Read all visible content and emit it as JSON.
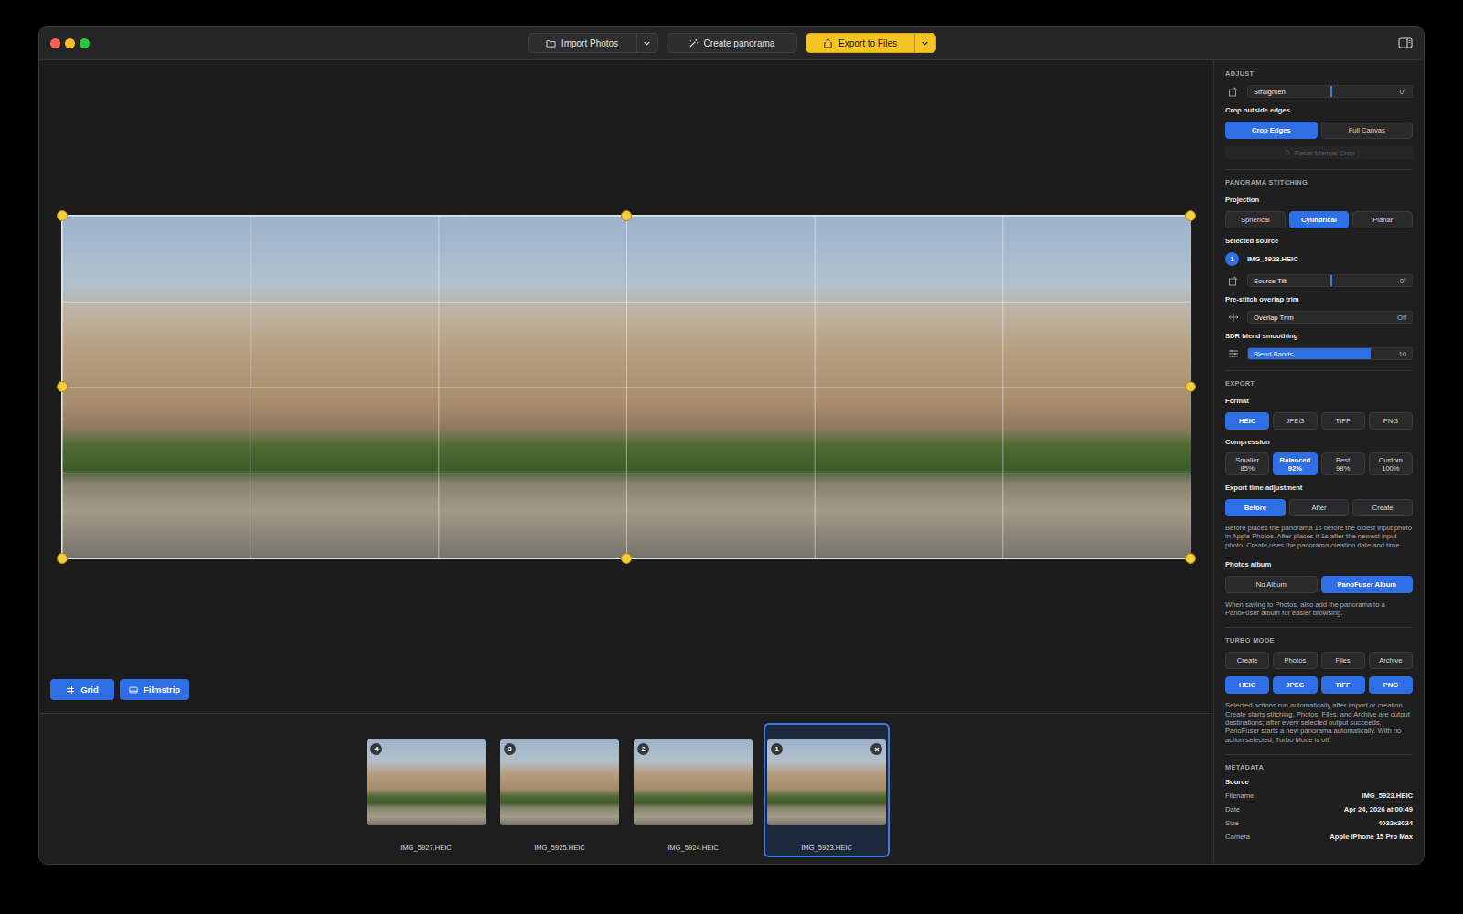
{
  "toolbar": {
    "buttons": [
      {
        "label": "Import Photos",
        "kind": "split",
        "primary": false,
        "icon": "folder"
      },
      {
        "label": "Create panorama",
        "kind": "plain",
        "primary": false,
        "icon": "wand"
      },
      {
        "label": "Export to Files",
        "kind": "split",
        "primary": true,
        "icon": "share"
      }
    ]
  },
  "view_buttons": [
    {
      "label": "Grid",
      "selected": true,
      "icon": "grid"
    },
    {
      "label": "Filmstrip",
      "selected": true,
      "icon": "filmstrip"
    }
  ],
  "filmstrip": [
    {
      "badge": "4",
      "filename": "IMG_5927.HEIC",
      "selected": false
    },
    {
      "badge": "3",
      "filename": "IMG_5925.HEIC",
      "selected": false
    },
    {
      "badge": "2",
      "filename": "IMG_5924.HEIC",
      "selected": false
    },
    {
      "badge": "1",
      "filename": "IMG_5923.HEIC",
      "selected": true
    }
  ],
  "adjust": {
    "heading": "ADJUST",
    "straighten": {
      "label": "Straighten",
      "value": "0°",
      "level": 0.5,
      "kind": "marker"
    },
    "crop": {
      "label": "Crop outside edges",
      "options": [
        {
          "label": "Crop Edges",
          "selected": true
        },
        {
          "label": "Full Canvas",
          "selected": false
        }
      ],
      "reset": {
        "label": "Reset Manual Crop",
        "disabled": true
      }
    }
  },
  "stitching": {
    "heading": "PANORAMA STITCHING",
    "projection": {
      "label": "Projection",
      "options": [
        {
          "label": "Spherical",
          "selected": false
        },
        {
          "label": "Cylindrical",
          "selected": true
        },
        {
          "label": "Planar",
          "selected": false
        }
      ]
    },
    "source": {
      "label": "Selected source",
      "badge": "1",
      "filename": "IMG_5923.HEIC",
      "tilt": {
        "label": "Source Tilt",
        "value": "0°",
        "level": 0.5,
        "kind": "marker"
      }
    },
    "overlap": {
      "label": "Pre-stitch overlap trim",
      "slider": {
        "label": "Overlap Trim",
        "value": "Off",
        "level": 0,
        "kind": "fill"
      }
    },
    "blend": {
      "label": "SDR blend smoothing",
      "slider": {
        "label": "Blend Bands",
        "value": "10",
        "level": 0.75,
        "kind": "fill"
      }
    }
  },
  "export": {
    "heading": "EXPORT",
    "format": {
      "label": "Format",
      "options": [
        {
          "label": "HEIC",
          "selected": true
        },
        {
          "label": "JPEG",
          "selected": false
        },
        {
          "label": "TIFF",
          "selected": false
        },
        {
          "label": "PNG",
          "selected": false
        }
      ]
    },
    "compression": {
      "label": "Compression",
      "options": [
        {
          "label": "Smaller",
          "value": "85%",
          "selected": false
        },
        {
          "label": "Balanced",
          "value": "92%",
          "selected": true
        },
        {
          "label": "Best",
          "value": "98%",
          "selected": false
        },
        {
          "label": "Custom",
          "value": "100%",
          "selected": false
        }
      ]
    },
    "time": {
      "label": "Export time adjustment",
      "options": [
        {
          "label": "Before",
          "selected": true
        },
        {
          "label": "After",
          "selected": false
        },
        {
          "label": "Create",
          "selected": false
        }
      ],
      "note": "Before places the panorama 1s before the oldest input photo in Apple Photos. After places it 1s after the newest input photo. Create uses the panorama creation date and time."
    },
    "album": {
      "label": "Photos album",
      "options": [
        {
          "label": "No Album",
          "selected": false
        },
        {
          "label": "PanoFuser Album",
          "selected": true
        }
      ],
      "note": "When saving to Photos, also add the panorama to a PanoFuser album for easier browsing."
    }
  },
  "turbo": {
    "heading": "TURBO MODE",
    "actions": [
      {
        "label": "Create",
        "selected": false
      },
      {
        "label": "Photos",
        "selected": false
      },
      {
        "label": "Files",
        "selected": false
      },
      {
        "label": "Archive",
        "selected": false
      }
    ],
    "formats": [
      {
        "label": "HEIC",
        "selected": true
      },
      {
        "label": "JPEG",
        "selected": true
      },
      {
        "label": "TIFF",
        "selected": true
      },
      {
        "label": "PNG",
        "selected": true
      }
    ],
    "note": "Selected actions run automatically after import or creation. Create starts stitching. Photos, Files, and Archive are output destinations; after every selected output succeeds, PanoFuser starts a new panorama automatically. With no action selected, Turbo Mode is off."
  },
  "metadata": {
    "heading": "METADATA",
    "subheading": "Source",
    "rows": [
      {
        "label": "Filename",
        "value": "IMG_5923.HEIC"
      },
      {
        "label": "Date",
        "value": "Apr 24, 2026 at 00:49"
      },
      {
        "label": "Size",
        "value": "4032x3024"
      },
      {
        "label": "Camera",
        "value": "Apple iPhone 15 Pro Max"
      }
    ]
  }
}
